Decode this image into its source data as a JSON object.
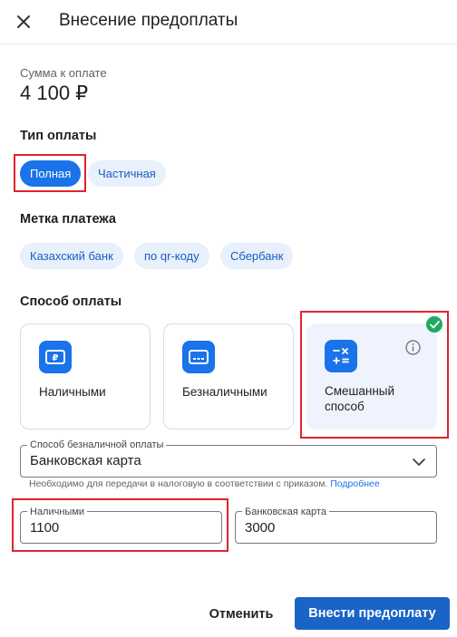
{
  "header": {
    "title": "Внесение предоплаты",
    "close_icon": "close-icon"
  },
  "amount": {
    "label": "Сумма к оплате",
    "value": "4 100 ₽"
  },
  "payment_type": {
    "title": "Тип оплаты",
    "options": [
      {
        "label": "Полная",
        "selected": true
      },
      {
        "label": "Частичная",
        "selected": false
      }
    ]
  },
  "payment_tag": {
    "title": "Метка платежа",
    "options": [
      {
        "label": "Казахский банк"
      },
      {
        "label": "по qr-коду"
      },
      {
        "label": "Сбербанк"
      }
    ]
  },
  "payment_method": {
    "title": "Способ оплаты",
    "cards": [
      {
        "label": "Наличными",
        "icon": "cash-icon",
        "selected": false
      },
      {
        "label": "Безналичными",
        "icon": "card-icon",
        "selected": false
      },
      {
        "label": "Смешанный способ",
        "icon": "calculator-icon",
        "selected": true
      }
    ],
    "selected_icon": "check-icon",
    "info_icon": "info-icon"
  },
  "cashless_select": {
    "label": "Способ безналичной оплаты",
    "value": "Банковская карта",
    "hint": "Необходимо для передачи в налоговую в соответствии с приказом.",
    "hint_link": "Подробнее"
  },
  "split": {
    "cash": {
      "label": "Наличными",
      "value": "1100"
    },
    "card": {
      "label": "Банковская карта",
      "value": "3000"
    }
  },
  "footer": {
    "cancel": "Отменить",
    "submit": "Внести предоплату"
  },
  "colors": {
    "accent": "#1a73e8",
    "chip_bg": "#e8f0fb",
    "success": "#1faa61",
    "highlight": "#e0232e"
  }
}
